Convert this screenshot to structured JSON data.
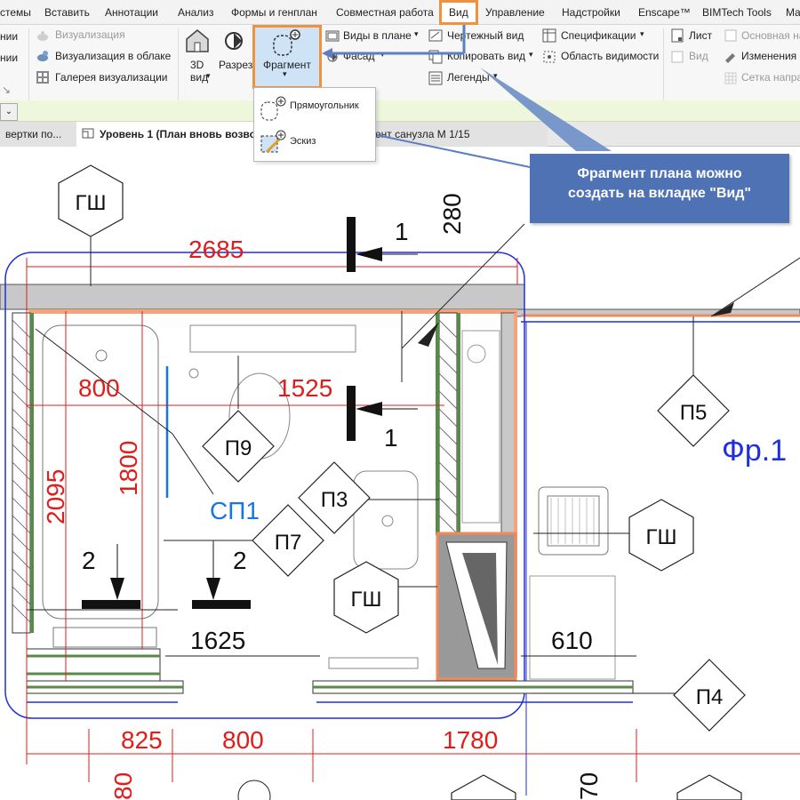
{
  "menubar": {
    "tabs": [
      "стемы",
      "Вставить",
      "Аннотации",
      "Анализ",
      "Формы и генплан",
      "Совместная работа",
      "Вид",
      "Управление",
      "Надстройки",
      "Enscape™",
      "BIMTech Tools",
      "Ma"
    ],
    "active_tab": "Вид"
  },
  "ribbon": {
    "left_cut_top": "нии",
    "left_cut_mid": "нии",
    "vis_label": "Визуализация",
    "vis_cloud_label": "Визуализация  в облаке",
    "gallery_label": "Галерея  визуализации",
    "view3d_label": "3D",
    "view3d_label2": "вид",
    "section_label": "Разрез",
    "fragment_label": "Фрагмент",
    "plan_views_label": "Виды в плане",
    "facade_label": "Фасад",
    "drafting_view_label": "Чертежный вид",
    "copy_view_label": "Копировать вид",
    "legends_label": "Легенды",
    "schedules_label": "Спецификации",
    "scope_box_label": "Область видимости",
    "sheet_label": "Лист",
    "view_label": "Вид",
    "main_label": "Основная на",
    "revisions_label": "Изменения",
    "grid_label": "Сетка напра"
  },
  "dropdown": {
    "items": [
      {
        "label": "Прямоугольник",
        "icon": "rectangle-callout-icon"
      },
      {
        "label": "Эскиз",
        "icon": "sketch-callout-icon"
      }
    ]
  },
  "view_tabs": {
    "left_cut": "вертки по...",
    "active": "Уровень 1 (План вновь возво",
    "right_cut": "ент санузла М 1/15"
  },
  "callout": {
    "line1": "Фрагмент плана можно",
    "line2": "создать на вкладке \"Вид\""
  },
  "drawing": {
    "dims": [
      "2685",
      "800",
      "1525",
      "2095",
      "1800",
      "280",
      "1625",
      "610",
      "825",
      "800",
      "1780",
      "80",
      "70"
    ],
    "tags": [
      "ГШ",
      "П9",
      "П3",
      "П7",
      "П5",
      "ГШ",
      "ГШ",
      "П4"
    ],
    "section_marks": [
      "1",
      "1",
      "2",
      "2"
    ],
    "sp1_label": "СП1",
    "fr_label": "Фр.1"
  },
  "colors": {
    "highlight": "#f0923d",
    "callout_bg": "#4f72b5",
    "dim_red": "#e21b1b",
    "tag_blue": "#1875e6",
    "boundary_blue": "#1e2ee0"
  }
}
